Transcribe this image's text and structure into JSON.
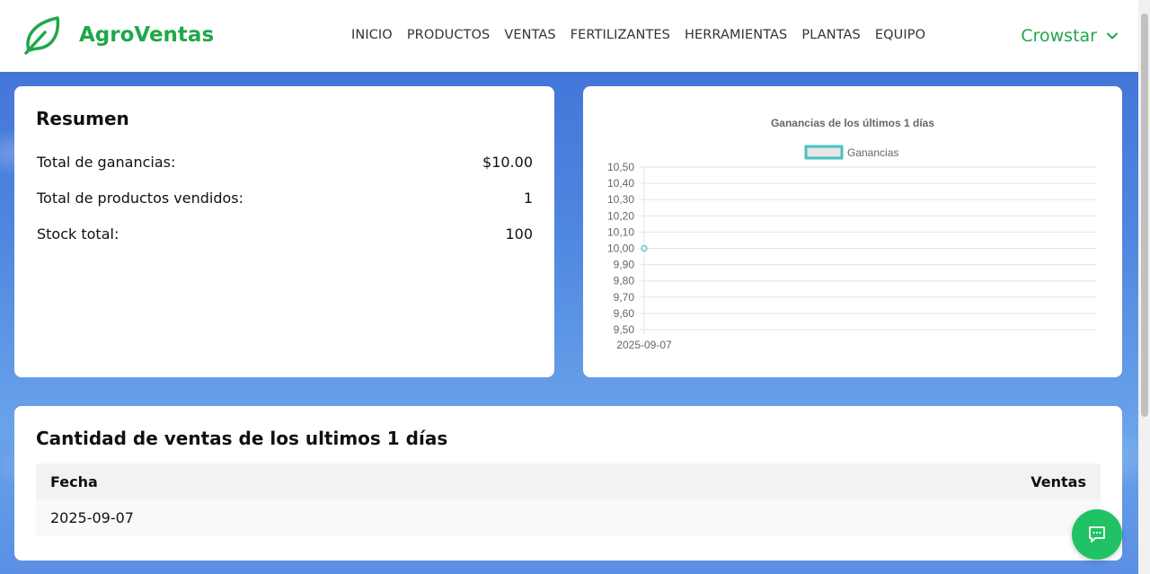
{
  "header": {
    "brand": "AgroVentas",
    "logo_icon": "leaf-icon",
    "nav": [
      "INICIO",
      "PRODUCTOS",
      "VENTAS",
      "FERTILIZANTES",
      "HERRAMIENTAS",
      "PLANTAS",
      "EQUIPO"
    ],
    "user": "Crowstar",
    "accent": "#1ea84a"
  },
  "summary": {
    "title": "Resumen",
    "rows": [
      {
        "label": "Total de ganancias:",
        "value": "$10.00"
      },
      {
        "label": "Total de productos vendidos:",
        "value": "1"
      },
      {
        "label": "Stock total:",
        "value": "100"
      }
    ]
  },
  "chart_data": {
    "type": "line",
    "title": "Ganancias de los últimos 1 días",
    "categories": [
      "2025-09-07"
    ],
    "series": [
      {
        "name": "Ganancias",
        "values": [
          10
        ],
        "color": "#4bc0c0"
      }
    ],
    "ylim": [
      9.5,
      10.5
    ],
    "yticks": [
      "10,50",
      "10,40",
      "10,30",
      "10,20",
      "10,10",
      "10,00",
      "9,90",
      "9,80",
      "9,70",
      "9,60",
      "9,50"
    ],
    "grid": true,
    "legend": "top"
  },
  "sales_table": {
    "title": "Cantidad de ventas de los ultimos 1 días",
    "columns": [
      "Fecha",
      "Ventas"
    ],
    "rows": [
      [
        "2025-09-07",
        ""
      ]
    ]
  },
  "chat_button_icon": "chat-icon"
}
